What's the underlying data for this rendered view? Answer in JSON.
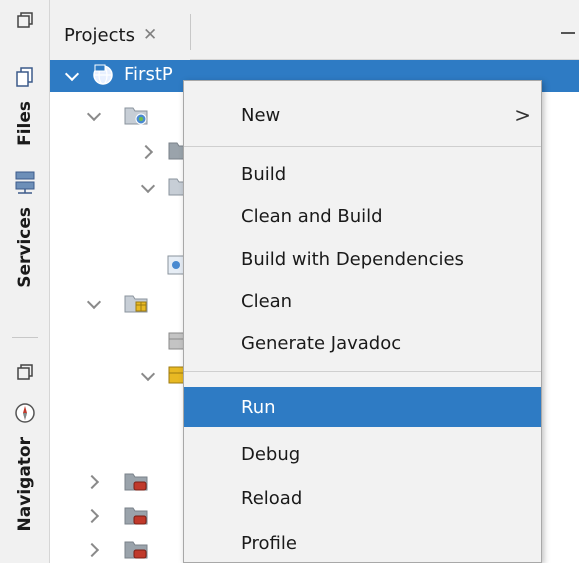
{
  "left_dock": {
    "files_label": "Files",
    "services_label": "Services",
    "navigator_label": "Navigator"
  },
  "projects_tab": {
    "title": "Projects",
    "close_glyph": "✕"
  },
  "tree": {
    "root_label": "FirstP"
  },
  "context_menu": {
    "new_label": "New",
    "new_arrow": ">",
    "build_label": "Build",
    "clean_build_label": "Clean and Build",
    "build_deps_label": "Build with Dependencies",
    "clean_label": "Clean",
    "javadoc_label": "Generate Javadoc",
    "run_label": "Run",
    "debug_label": "Debug",
    "reload_label": "Reload",
    "profile_label": "Profile"
  },
  "colors": {
    "selection": "#2e7bc4",
    "menu_background": "#f2f2f2",
    "dock_background": "#f1f1f1"
  }
}
